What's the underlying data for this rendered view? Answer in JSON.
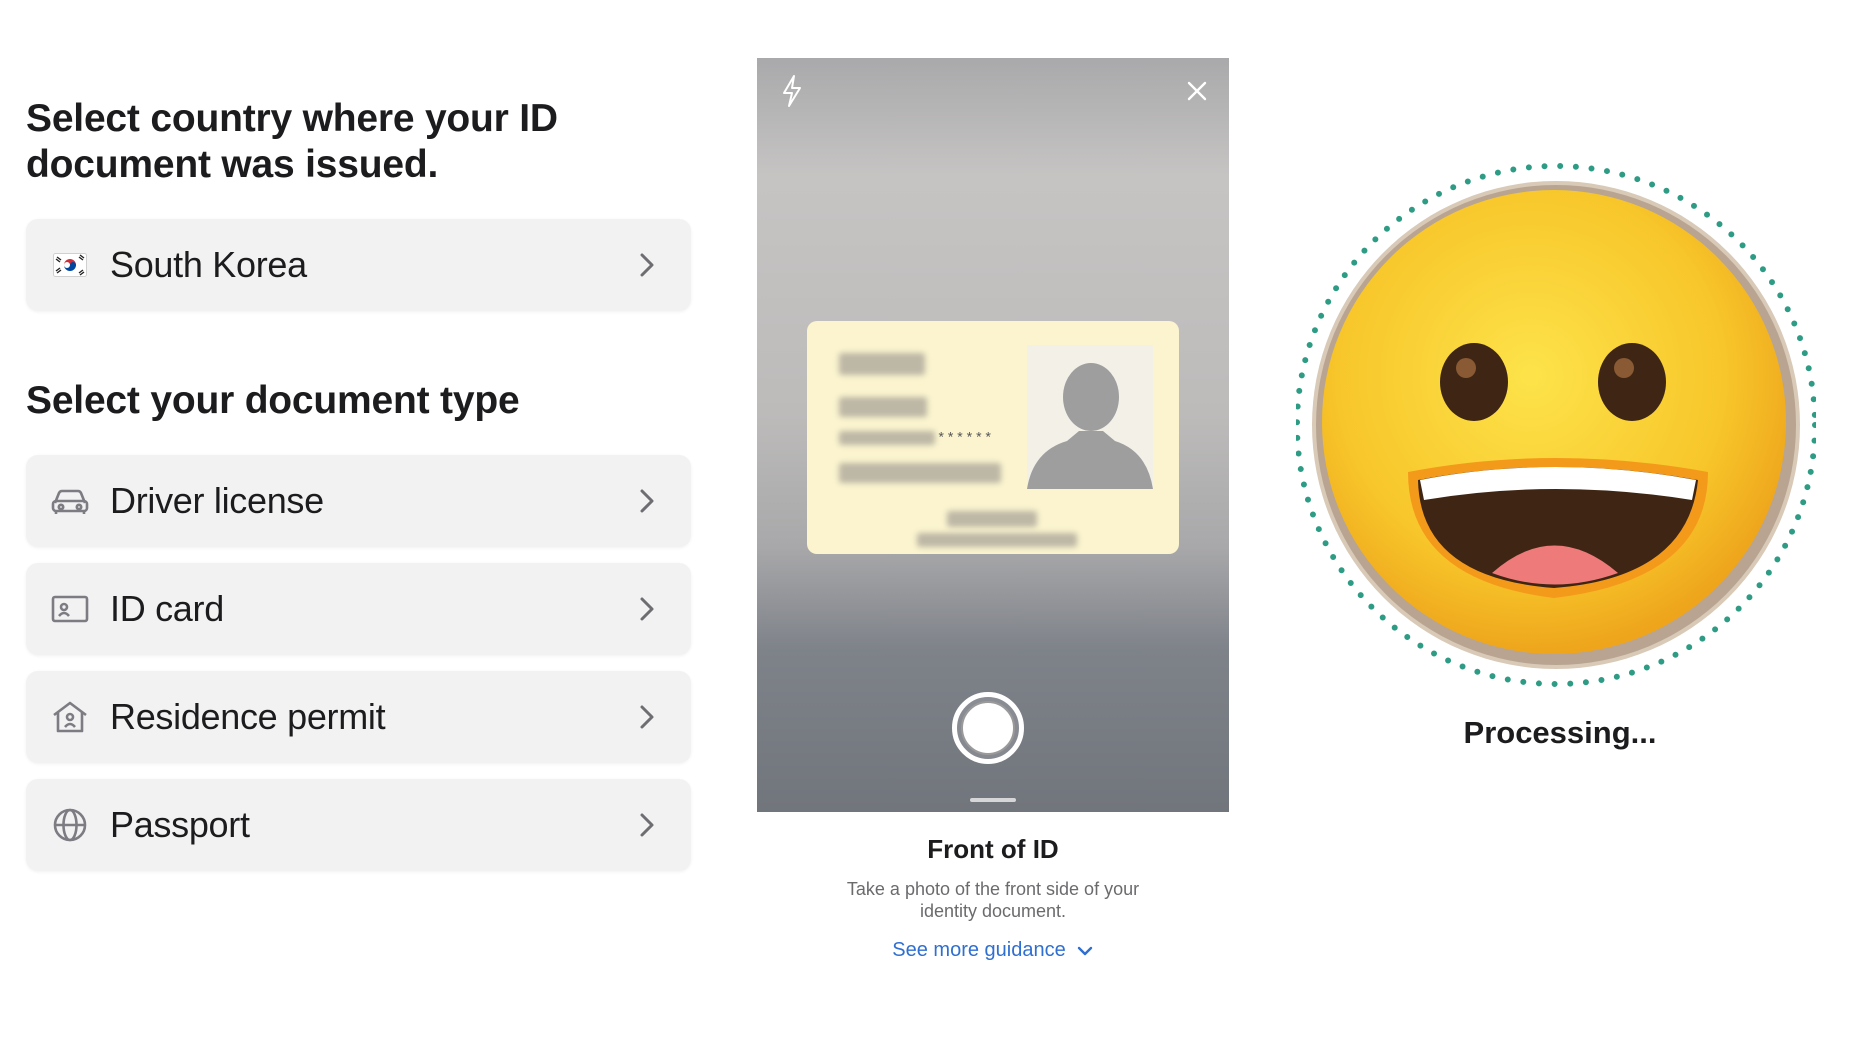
{
  "country_section": {
    "heading": "Select country where your ID document was issued.",
    "selected_country": "South Korea",
    "flag_icon": "south-korea-flag-icon"
  },
  "document_section": {
    "heading": "Select your document type",
    "options": [
      {
        "label": "Driver license",
        "icon": "car-icon"
      },
      {
        "label": "ID card",
        "icon": "id-card-icon"
      },
      {
        "label": "Residence permit",
        "icon": "house-icon"
      },
      {
        "label": "Passport",
        "icon": "globe-icon"
      }
    ]
  },
  "camera": {
    "flash_icon": "flash-icon",
    "close_icon": "close-icon",
    "masked_digits": "******",
    "sheet_title": "Front of ID",
    "sheet_subtitle": "Take a photo of the front side of your identity document.",
    "guidance_link": "See more guidance"
  },
  "processing": {
    "status": "Processing...",
    "icon": "grinning-face-emoji",
    "ring_color": "#2e9c84"
  },
  "colors": {
    "row_background": "#f2f2f3",
    "link": "#2f6fd1",
    "heading": "#1c1c1e"
  }
}
